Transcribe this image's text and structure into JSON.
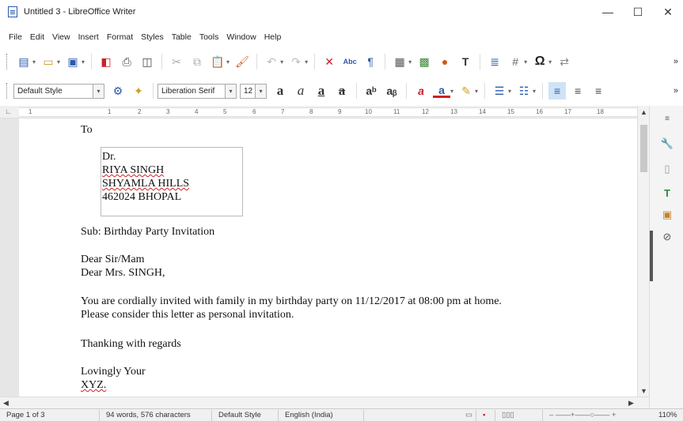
{
  "window": {
    "title": "Untitled 3 - LibreOffice Writer",
    "minimize": "—",
    "maximize": "☐",
    "close": "✕"
  },
  "menu": [
    "File",
    "Edit",
    "View",
    "Insert",
    "Format",
    "Styles",
    "Table",
    "Tools",
    "Window",
    "Help"
  ],
  "formatting": {
    "paragraph_style": "Default Style",
    "font_name": "Liberation Serif",
    "font_size": "12"
  },
  "ruler": {
    "marks": [
      "1",
      "1",
      "2",
      "3",
      "4",
      "5",
      "6",
      "7",
      "8",
      "9",
      "10",
      "11",
      "12",
      "13",
      "14",
      "15",
      "16",
      "17",
      "18"
    ]
  },
  "document": {
    "to": "To",
    "address": [
      "Dr.",
      "RIYA  SINGH",
      "SHYAMLA HILLS",
      "462024 BHOPAL"
    ],
    "subject": "Sub: Birthday Party Invitation",
    "salutation1": "Dear Sir/Mam",
    "salutation2": "Dear Mrs. SINGH,",
    "body1": "You are cordially invited with family in my birthday party on 11/12/2017 at 08:00 pm at home.",
    "body2": "Please consider this letter as personal invitation.",
    "thanks": "Thanking with regards",
    "closing": "Lovingly Your",
    "signature": "XYZ."
  },
  "statusbar": {
    "page": "Page 1 of 3",
    "counts": "94 words, 576 characters",
    "page_style": "Default Style",
    "language": "English (India)",
    "zoom": "110%"
  }
}
